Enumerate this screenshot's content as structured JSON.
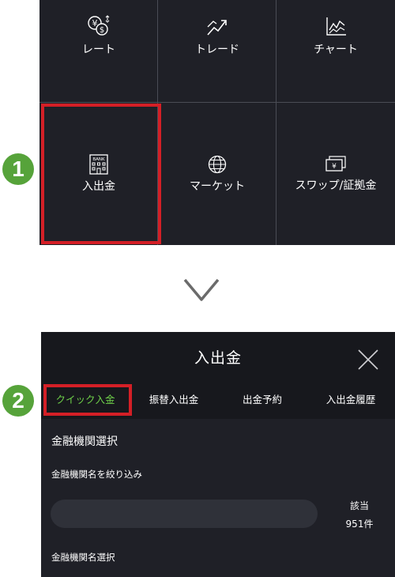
{
  "menu": {
    "items": [
      {
        "label": "レート",
        "icon": "yen-dollar-icon"
      },
      {
        "label": "トレード",
        "icon": "trade-arrow-icon"
      },
      {
        "label": "チャート",
        "icon": "chart-icon"
      },
      {
        "label": "入出金",
        "icon": "bank-icon",
        "bank_text": "BANK"
      },
      {
        "label": "マーケット",
        "icon": "globe-icon"
      },
      {
        "label": "スワップ/証拠金",
        "icon": "banknote-icon"
      }
    ]
  },
  "steps": [
    "1",
    "2"
  ],
  "panel": {
    "title": "入出金",
    "tabs": [
      {
        "label": "クイック入金",
        "active": true
      },
      {
        "label": "振替入出金",
        "active": false
      },
      {
        "label": "出金予約",
        "active": false
      },
      {
        "label": "入出金履歴",
        "active": false
      }
    ],
    "section_title": "金融機関選択",
    "filter_label": "金融機関名を絞り込み",
    "search_value": "",
    "match_label": "該当",
    "match_count": "951件",
    "select_label": "金融機関名選択"
  },
  "colors": {
    "highlight": "#d41f26",
    "accent": "#6fd14a",
    "step_badge": "#56a33a",
    "panel_bg": "#1f2027"
  }
}
